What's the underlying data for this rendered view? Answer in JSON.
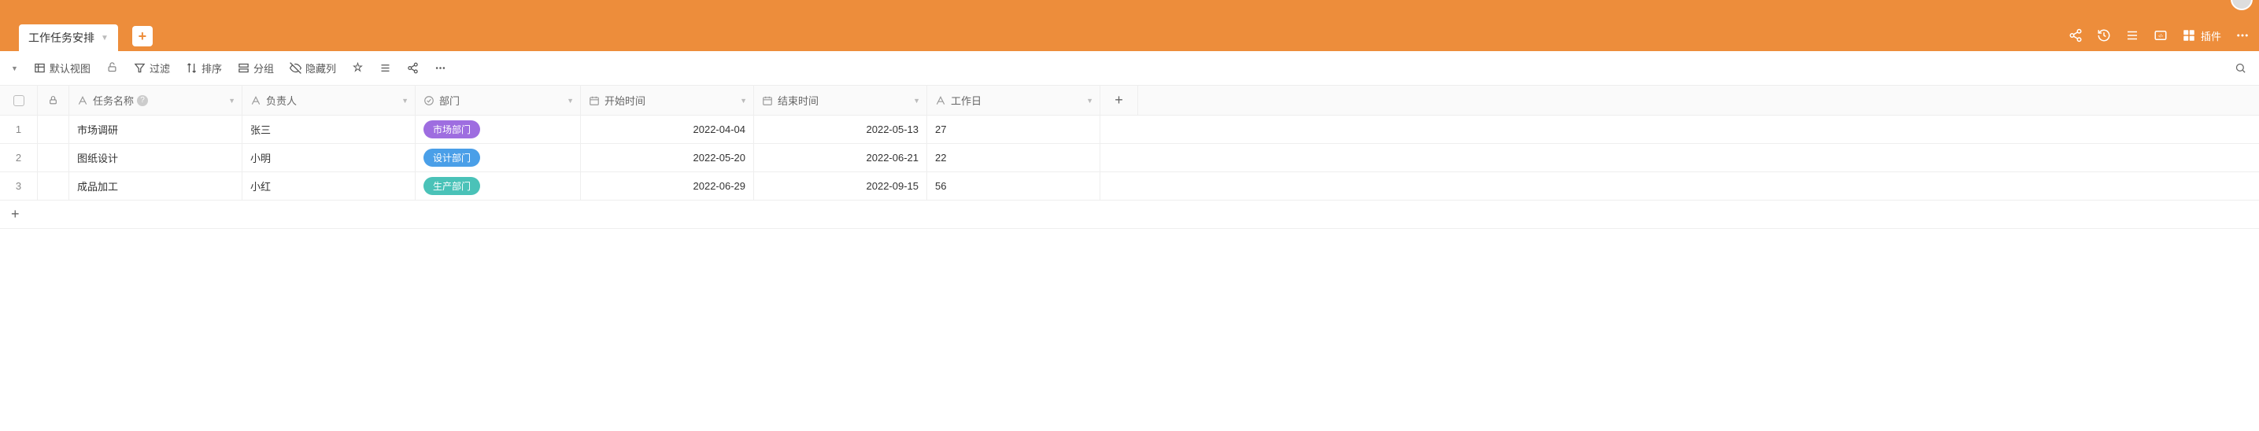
{
  "tab": {
    "name": "工作任务安排"
  },
  "plugin_label": "插件",
  "toolbar": {
    "view": "默认视图",
    "filter": "过滤",
    "sort": "排序",
    "group": "分组",
    "hide": "隐藏列"
  },
  "columns": {
    "task": "任务名称",
    "owner": "负责人",
    "dept": "部门",
    "start": "开始时间",
    "end": "结束时间",
    "days": "工作日"
  },
  "rows": [
    {
      "n": "1",
      "task": "市场调研",
      "owner": "张三",
      "dept": "市场部门",
      "dept_color": "tag-purple",
      "start": "2022-04-04",
      "end": "2022-05-13",
      "days": "27"
    },
    {
      "n": "2",
      "task": "图纸设计",
      "owner": "小明",
      "dept": "设计部门",
      "dept_color": "tag-blue",
      "start": "2022-05-20",
      "end": "2022-06-21",
      "days": "22"
    },
    {
      "n": "3",
      "task": "成品加工",
      "owner": "小红",
      "dept": "生产部门",
      "dept_color": "tag-teal",
      "start": "2022-06-29",
      "end": "2022-09-15",
      "days": "56"
    }
  ]
}
